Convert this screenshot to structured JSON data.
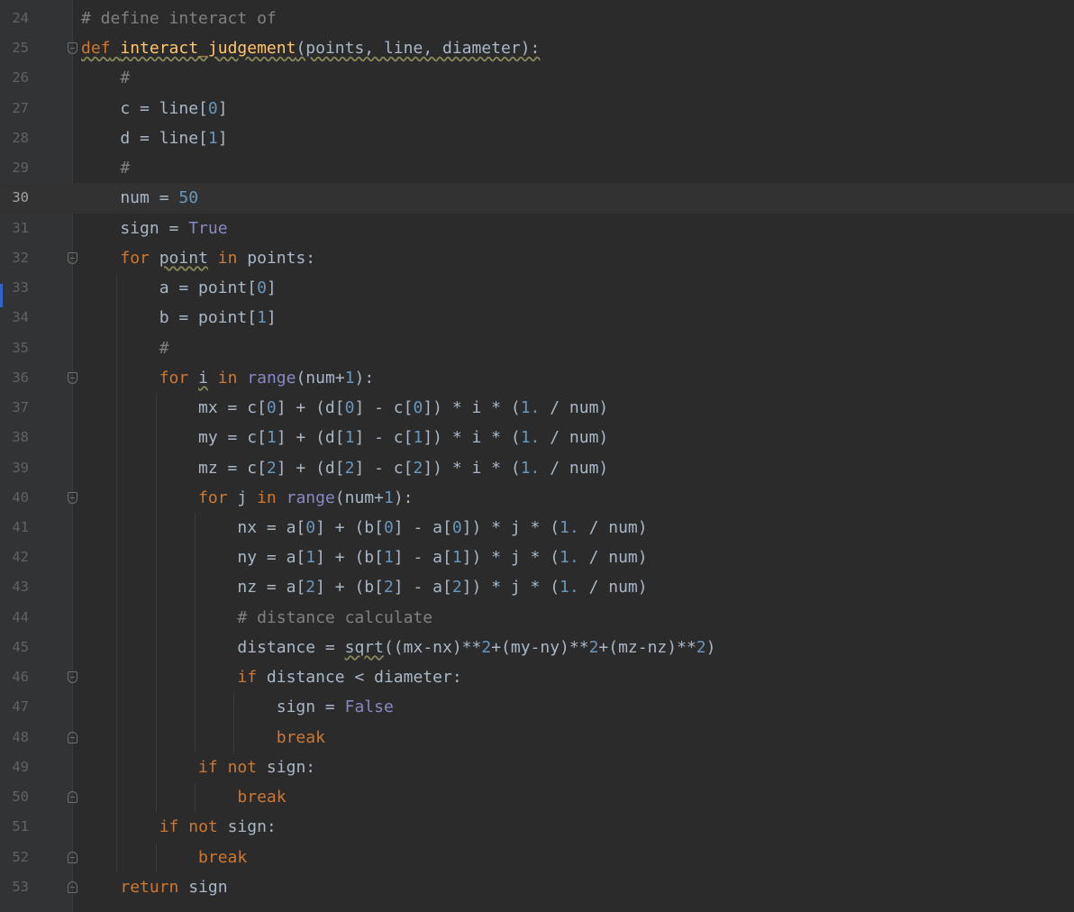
{
  "editor": {
    "current_line": 30,
    "lines": [
      {
        "n": "24",
        "fold": "",
        "segs": [
          {
            "t": "# define interact of",
            "c": "cm"
          }
        ]
      },
      {
        "n": "25",
        "fold": "open",
        "segs": [
          {
            "t": "def",
            "c": "kw sq"
          },
          {
            "t": " ",
            "c": "sq"
          },
          {
            "t": "interact_judgement",
            "c": "fn sq"
          },
          {
            "t": "(points, line, diameter):",
            "c": "sq"
          }
        ]
      },
      {
        "n": "26",
        "fold": "",
        "segs": [
          {
            "t": "    "
          },
          {
            "t": "#",
            "c": "cm"
          }
        ]
      },
      {
        "n": "27",
        "fold": "",
        "segs": [
          {
            "t": "    c = line["
          },
          {
            "t": "0",
            "c": "num"
          },
          {
            "t": "]"
          }
        ]
      },
      {
        "n": "28",
        "fold": "",
        "segs": [
          {
            "t": "    d = line["
          },
          {
            "t": "1",
            "c": "num"
          },
          {
            "t": "]"
          }
        ]
      },
      {
        "n": "29",
        "fold": "",
        "segs": [
          {
            "t": "    "
          },
          {
            "t": "#",
            "c": "cm"
          }
        ]
      },
      {
        "n": "30",
        "fold": "",
        "segs": [
          {
            "t": "    num = "
          },
          {
            "t": "50",
            "c": "num"
          }
        ]
      },
      {
        "n": "31",
        "fold": "",
        "segs": [
          {
            "t": "    sign = "
          },
          {
            "t": "True",
            "c": "bi"
          }
        ]
      },
      {
        "n": "32",
        "fold": "open",
        "segs": [
          {
            "t": "    "
          },
          {
            "t": "for",
            "c": "kw"
          },
          {
            "t": " "
          },
          {
            "t": "point",
            "c": "sq"
          },
          {
            "t": " "
          },
          {
            "t": "in",
            "c": "kw"
          },
          {
            "t": " points:"
          }
        ]
      },
      {
        "n": "33",
        "fold": "",
        "segs": [
          {
            "t": "        a = point["
          },
          {
            "t": "0",
            "c": "num"
          },
          {
            "t": "]"
          }
        ]
      },
      {
        "n": "34",
        "fold": "",
        "segs": [
          {
            "t": "        b = point["
          },
          {
            "t": "1",
            "c": "num"
          },
          {
            "t": "]"
          }
        ]
      },
      {
        "n": "35",
        "fold": "",
        "segs": [
          {
            "t": "        "
          },
          {
            "t": "#",
            "c": "cm"
          }
        ]
      },
      {
        "n": "36",
        "fold": "open",
        "segs": [
          {
            "t": "        "
          },
          {
            "t": "for",
            "c": "kw"
          },
          {
            "t": " "
          },
          {
            "t": "i",
            "c": "sq"
          },
          {
            "t": " "
          },
          {
            "t": "in",
            "c": "kw"
          },
          {
            "t": " "
          },
          {
            "t": "range",
            "c": "bi"
          },
          {
            "t": "(num+"
          },
          {
            "t": "1",
            "c": "num"
          },
          {
            "t": "):"
          }
        ]
      },
      {
        "n": "37",
        "fold": "",
        "segs": [
          {
            "t": "            mx = c["
          },
          {
            "t": "0",
            "c": "num"
          },
          {
            "t": "] + (d["
          },
          {
            "t": "0",
            "c": "num"
          },
          {
            "t": "] - c["
          },
          {
            "t": "0",
            "c": "num"
          },
          {
            "t": "]) * i * ("
          },
          {
            "t": "1.",
            "c": "num"
          },
          {
            "t": " / num)"
          }
        ]
      },
      {
        "n": "38",
        "fold": "",
        "segs": [
          {
            "t": "            my = c["
          },
          {
            "t": "1",
            "c": "num"
          },
          {
            "t": "] + (d["
          },
          {
            "t": "1",
            "c": "num"
          },
          {
            "t": "] - c["
          },
          {
            "t": "1",
            "c": "num"
          },
          {
            "t": "]) * i * ("
          },
          {
            "t": "1.",
            "c": "num"
          },
          {
            "t": " / num)"
          }
        ]
      },
      {
        "n": "39",
        "fold": "",
        "segs": [
          {
            "t": "            mz = c["
          },
          {
            "t": "2",
            "c": "num"
          },
          {
            "t": "] + (d["
          },
          {
            "t": "2",
            "c": "num"
          },
          {
            "t": "] - c["
          },
          {
            "t": "2",
            "c": "num"
          },
          {
            "t": "]) * i * ("
          },
          {
            "t": "1.",
            "c": "num"
          },
          {
            "t": " / num)"
          }
        ]
      },
      {
        "n": "40",
        "fold": "open",
        "segs": [
          {
            "t": "            "
          },
          {
            "t": "for",
            "c": "kw"
          },
          {
            "t": " j "
          },
          {
            "t": "in",
            "c": "kw"
          },
          {
            "t": " "
          },
          {
            "t": "range",
            "c": "bi"
          },
          {
            "t": "(num+"
          },
          {
            "t": "1",
            "c": "num"
          },
          {
            "t": "):"
          }
        ]
      },
      {
        "n": "41",
        "fold": "",
        "segs": [
          {
            "t": "                nx = a["
          },
          {
            "t": "0",
            "c": "num"
          },
          {
            "t": "] + (b["
          },
          {
            "t": "0",
            "c": "num"
          },
          {
            "t": "] - a["
          },
          {
            "t": "0",
            "c": "num"
          },
          {
            "t": "]) * j * ("
          },
          {
            "t": "1.",
            "c": "num"
          },
          {
            "t": " / num)"
          }
        ]
      },
      {
        "n": "42",
        "fold": "",
        "segs": [
          {
            "t": "                ny = a["
          },
          {
            "t": "1",
            "c": "num"
          },
          {
            "t": "] + (b["
          },
          {
            "t": "1",
            "c": "num"
          },
          {
            "t": "] - a["
          },
          {
            "t": "1",
            "c": "num"
          },
          {
            "t": "]) * j * ("
          },
          {
            "t": "1.",
            "c": "num"
          },
          {
            "t": " / num)"
          }
        ]
      },
      {
        "n": "43",
        "fold": "",
        "segs": [
          {
            "t": "                nz = a["
          },
          {
            "t": "2",
            "c": "num"
          },
          {
            "t": "] + (b["
          },
          {
            "t": "2",
            "c": "num"
          },
          {
            "t": "] - a["
          },
          {
            "t": "2",
            "c": "num"
          },
          {
            "t": "]) * j * ("
          },
          {
            "t": "1.",
            "c": "num"
          },
          {
            "t": " / num)"
          }
        ]
      },
      {
        "n": "44",
        "fold": "",
        "segs": [
          {
            "t": "                "
          },
          {
            "t": "# distance calculate",
            "c": "cm"
          }
        ]
      },
      {
        "n": "45",
        "fold": "",
        "segs": [
          {
            "t": "                distance = "
          },
          {
            "t": "sqrt",
            "c": "sq"
          },
          {
            "t": "((mx-nx)**"
          },
          {
            "t": "2",
            "c": "num"
          },
          {
            "t": "+(my-ny)**"
          },
          {
            "t": "2",
            "c": "num"
          },
          {
            "t": "+(mz-nz)**"
          },
          {
            "t": "2",
            "c": "num"
          },
          {
            "t": ")"
          }
        ]
      },
      {
        "n": "46",
        "fold": "open",
        "segs": [
          {
            "t": "                "
          },
          {
            "t": "if",
            "c": "kw"
          },
          {
            "t": " distance < diameter:"
          }
        ]
      },
      {
        "n": "47",
        "fold": "",
        "segs": [
          {
            "t": "                    sign = "
          },
          {
            "t": "False",
            "c": "bi"
          }
        ]
      },
      {
        "n": "48",
        "fold": "close",
        "segs": [
          {
            "t": "                    "
          },
          {
            "t": "break",
            "c": "kw"
          }
        ]
      },
      {
        "n": "49",
        "fold": "",
        "segs": [
          {
            "t": "            "
          },
          {
            "t": "if",
            "c": "kw"
          },
          {
            "t": " "
          },
          {
            "t": "not",
            "c": "kw"
          },
          {
            "t": " sign:"
          }
        ]
      },
      {
        "n": "50",
        "fold": "close",
        "segs": [
          {
            "t": "                "
          },
          {
            "t": "break",
            "c": "kw"
          }
        ]
      },
      {
        "n": "51",
        "fold": "",
        "segs": [
          {
            "t": "        "
          },
          {
            "t": "if",
            "c": "kw"
          },
          {
            "t": " "
          },
          {
            "t": "not",
            "c": "kw"
          },
          {
            "t": " sign:"
          }
        ]
      },
      {
        "n": "52",
        "fold": "close",
        "segs": [
          {
            "t": "            "
          },
          {
            "t": "break",
            "c": "kw"
          }
        ]
      },
      {
        "n": "53",
        "fold": "close",
        "segs": [
          {
            "t": "    "
          },
          {
            "t": "return",
            "c": "kw"
          },
          {
            "t": " sign"
          }
        ]
      }
    ]
  }
}
